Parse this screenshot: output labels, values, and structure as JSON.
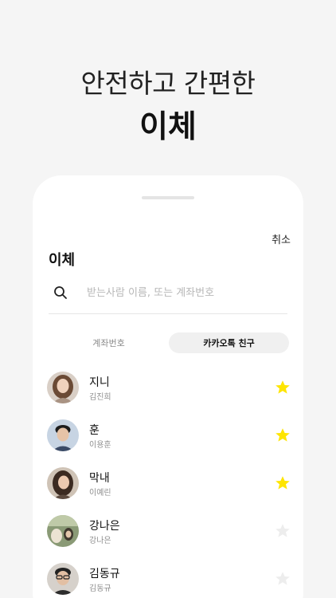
{
  "hero": {
    "line1": "안전하고 간편한",
    "line2": "이체"
  },
  "modal": {
    "cancel_label": "취소",
    "title": "이체",
    "search": {
      "icon": "search-icon",
      "placeholder": "받는사람 이름, 또는 계좌번호",
      "value": ""
    },
    "tabs": [
      {
        "label": "계좌번호",
        "active": false
      },
      {
        "label": "카카오톡 친구",
        "active": true
      }
    ],
    "friends": [
      {
        "nickname": "지니",
        "real_name": "김진희",
        "favorite": true
      },
      {
        "nickname": "훈",
        "real_name": "이용훈",
        "favorite": true
      },
      {
        "nickname": "막내",
        "real_name": "이예린",
        "favorite": true
      },
      {
        "nickname": "강나은",
        "real_name": "강나은",
        "favorite": false
      },
      {
        "nickname": "김동규",
        "real_name": "김동규",
        "favorite": false
      }
    ]
  },
  "colors": {
    "star_active": "#FEE500",
    "star_inactive": "#EDEDED",
    "background": "#F5F5F5"
  }
}
